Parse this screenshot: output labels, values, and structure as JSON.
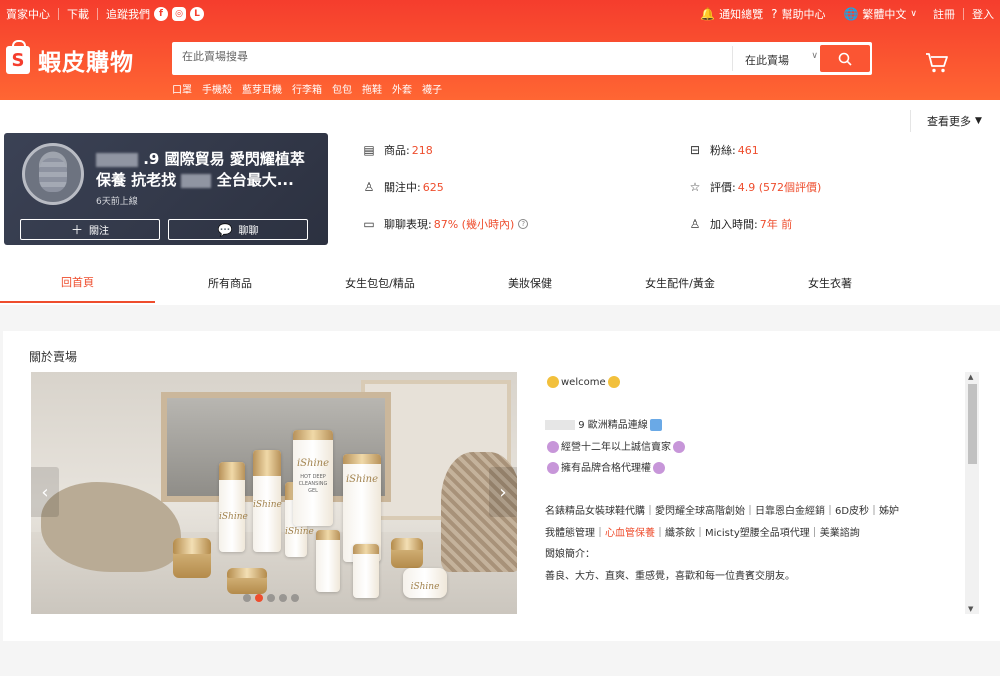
{
  "topbar": {
    "seller_center": "賣家中心",
    "download": "下載",
    "follow_us": "追蹤我們",
    "notifications": "通知總覽",
    "help": "幫助中心",
    "language": "繁體中文",
    "register": "註冊",
    "login": "登入"
  },
  "brand": {
    "logo_letter": "S",
    "name": "蝦皮購物"
  },
  "search": {
    "placeholder": "在此賣場搜尋",
    "scope": "在此賣場",
    "hot_keywords": [
      "口罩",
      "手機殼",
      "藍芽耳機",
      "行李箱",
      "包包",
      "拖鞋",
      "外套",
      "襪子"
    ]
  },
  "shop": {
    "name_line1": ".9 國際貿易 愛閃耀植萃",
    "name_line2a": "保養 抗老找",
    "name_line2b": "全台最大...",
    "last_seen": "6天前上線",
    "follow_label": "關注",
    "chat_label": "聊聊"
  },
  "stats": {
    "products_label": "商品:",
    "products_value": "218",
    "following_label": "關注中:",
    "following_value": "625",
    "chat_label": "聊聊表現:",
    "chat_value": "87% (幾小時內)",
    "followers_label": "粉絲:",
    "followers_value": "461",
    "rating_label": "評價:",
    "rating_value": "4.9 (572個評價)",
    "joined_label": "加入時間:",
    "joined_value": "7年 前"
  },
  "tabs": [
    {
      "label": "回首頁",
      "active": true
    },
    {
      "label": "所有商品",
      "active": false
    },
    {
      "label": "女生包包/精品",
      "active": false
    },
    {
      "label": "美妝保健",
      "active": false
    },
    {
      "label": "女生配件/黃金",
      "active": false
    },
    {
      "label": "女生衣著",
      "active": false
    }
  ],
  "tab_more": "查看更多",
  "about": {
    "title": "關於賣場",
    "banner_brand": "iShine",
    "banner_product_texts": [
      "HOT DEEP",
      "CLEANSING",
      "GEL"
    ],
    "carousel": {
      "count": 5,
      "active_index": 1
    },
    "desc": {
      "welcome": "welcome",
      "line1": "9 歐洲精品連線",
      "line2": "經營十二年以上誠信賣家",
      "line3": "擁有品牌合格代理權",
      "line4a": "名錶精品女裝球鞋代購｜愛閃耀全球高階創始｜日靠恩白金經銷｜6D皮秒｜姊妒",
      "line5a": "我體態管理｜",
      "line5red": "心血管保養",
      "line5b": "｜纖茶飲｜Micisty塑腰全品項代理｜美業諮詢",
      "line6": "闆娘簡介：",
      "line7": "善良、大方、直爽、重感覺，喜歡和每一位貴賓交朋友。"
    }
  },
  "colors": {
    "brand": "#ee4d2d",
    "header": "#f53d2d",
    "card": "#353a49"
  }
}
